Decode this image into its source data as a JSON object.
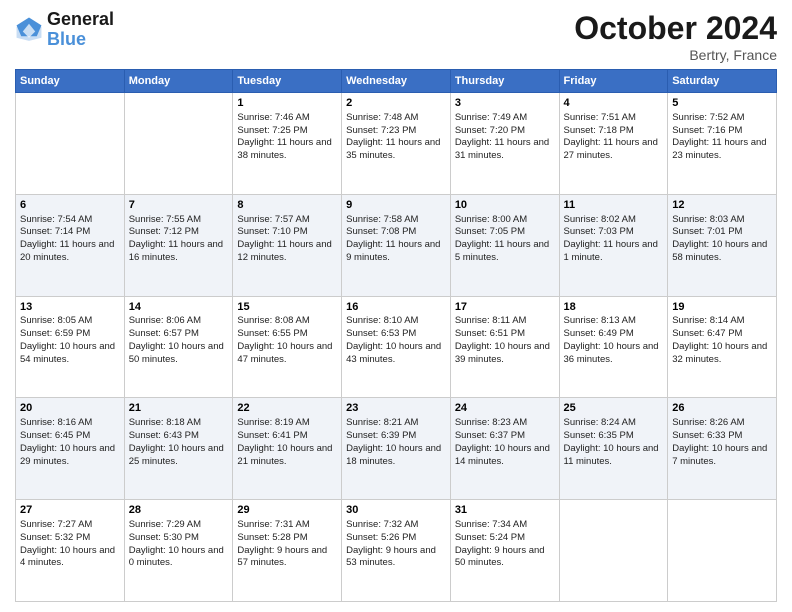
{
  "header": {
    "logo_line1": "General",
    "logo_line2": "Blue",
    "month_title": "October 2024",
    "location": "Bertry, France"
  },
  "days_of_week": [
    "Sunday",
    "Monday",
    "Tuesday",
    "Wednesday",
    "Thursday",
    "Friday",
    "Saturday"
  ],
  "weeks": [
    [
      {
        "day": "",
        "sunrise": "",
        "sunset": "",
        "daylight": ""
      },
      {
        "day": "",
        "sunrise": "",
        "sunset": "",
        "daylight": ""
      },
      {
        "day": "1",
        "sunrise": "Sunrise: 7:46 AM",
        "sunset": "Sunset: 7:25 PM",
        "daylight": "Daylight: 11 hours and 38 minutes."
      },
      {
        "day": "2",
        "sunrise": "Sunrise: 7:48 AM",
        "sunset": "Sunset: 7:23 PM",
        "daylight": "Daylight: 11 hours and 35 minutes."
      },
      {
        "day": "3",
        "sunrise": "Sunrise: 7:49 AM",
        "sunset": "Sunset: 7:20 PM",
        "daylight": "Daylight: 11 hours and 31 minutes."
      },
      {
        "day": "4",
        "sunrise": "Sunrise: 7:51 AM",
        "sunset": "Sunset: 7:18 PM",
        "daylight": "Daylight: 11 hours and 27 minutes."
      },
      {
        "day": "5",
        "sunrise": "Sunrise: 7:52 AM",
        "sunset": "Sunset: 7:16 PM",
        "daylight": "Daylight: 11 hours and 23 minutes."
      }
    ],
    [
      {
        "day": "6",
        "sunrise": "Sunrise: 7:54 AM",
        "sunset": "Sunset: 7:14 PM",
        "daylight": "Daylight: 11 hours and 20 minutes."
      },
      {
        "day": "7",
        "sunrise": "Sunrise: 7:55 AM",
        "sunset": "Sunset: 7:12 PM",
        "daylight": "Daylight: 11 hours and 16 minutes."
      },
      {
        "day": "8",
        "sunrise": "Sunrise: 7:57 AM",
        "sunset": "Sunset: 7:10 PM",
        "daylight": "Daylight: 11 hours and 12 minutes."
      },
      {
        "day": "9",
        "sunrise": "Sunrise: 7:58 AM",
        "sunset": "Sunset: 7:08 PM",
        "daylight": "Daylight: 11 hours and 9 minutes."
      },
      {
        "day": "10",
        "sunrise": "Sunrise: 8:00 AM",
        "sunset": "Sunset: 7:05 PM",
        "daylight": "Daylight: 11 hours and 5 minutes."
      },
      {
        "day": "11",
        "sunrise": "Sunrise: 8:02 AM",
        "sunset": "Sunset: 7:03 PM",
        "daylight": "Daylight: 11 hours and 1 minute."
      },
      {
        "day": "12",
        "sunrise": "Sunrise: 8:03 AM",
        "sunset": "Sunset: 7:01 PM",
        "daylight": "Daylight: 10 hours and 58 minutes."
      }
    ],
    [
      {
        "day": "13",
        "sunrise": "Sunrise: 8:05 AM",
        "sunset": "Sunset: 6:59 PM",
        "daylight": "Daylight: 10 hours and 54 minutes."
      },
      {
        "day": "14",
        "sunrise": "Sunrise: 8:06 AM",
        "sunset": "Sunset: 6:57 PM",
        "daylight": "Daylight: 10 hours and 50 minutes."
      },
      {
        "day": "15",
        "sunrise": "Sunrise: 8:08 AM",
        "sunset": "Sunset: 6:55 PM",
        "daylight": "Daylight: 10 hours and 47 minutes."
      },
      {
        "day": "16",
        "sunrise": "Sunrise: 8:10 AM",
        "sunset": "Sunset: 6:53 PM",
        "daylight": "Daylight: 10 hours and 43 minutes."
      },
      {
        "day": "17",
        "sunrise": "Sunrise: 8:11 AM",
        "sunset": "Sunset: 6:51 PM",
        "daylight": "Daylight: 10 hours and 39 minutes."
      },
      {
        "day": "18",
        "sunrise": "Sunrise: 8:13 AM",
        "sunset": "Sunset: 6:49 PM",
        "daylight": "Daylight: 10 hours and 36 minutes."
      },
      {
        "day": "19",
        "sunrise": "Sunrise: 8:14 AM",
        "sunset": "Sunset: 6:47 PM",
        "daylight": "Daylight: 10 hours and 32 minutes."
      }
    ],
    [
      {
        "day": "20",
        "sunrise": "Sunrise: 8:16 AM",
        "sunset": "Sunset: 6:45 PM",
        "daylight": "Daylight: 10 hours and 29 minutes."
      },
      {
        "day": "21",
        "sunrise": "Sunrise: 8:18 AM",
        "sunset": "Sunset: 6:43 PM",
        "daylight": "Daylight: 10 hours and 25 minutes."
      },
      {
        "day": "22",
        "sunrise": "Sunrise: 8:19 AM",
        "sunset": "Sunset: 6:41 PM",
        "daylight": "Daylight: 10 hours and 21 minutes."
      },
      {
        "day": "23",
        "sunrise": "Sunrise: 8:21 AM",
        "sunset": "Sunset: 6:39 PM",
        "daylight": "Daylight: 10 hours and 18 minutes."
      },
      {
        "day": "24",
        "sunrise": "Sunrise: 8:23 AM",
        "sunset": "Sunset: 6:37 PM",
        "daylight": "Daylight: 10 hours and 14 minutes."
      },
      {
        "day": "25",
        "sunrise": "Sunrise: 8:24 AM",
        "sunset": "Sunset: 6:35 PM",
        "daylight": "Daylight: 10 hours and 11 minutes."
      },
      {
        "day": "26",
        "sunrise": "Sunrise: 8:26 AM",
        "sunset": "Sunset: 6:33 PM",
        "daylight": "Daylight: 10 hours and 7 minutes."
      }
    ],
    [
      {
        "day": "27",
        "sunrise": "Sunrise: 7:27 AM",
        "sunset": "Sunset: 5:32 PM",
        "daylight": "Daylight: 10 hours and 4 minutes."
      },
      {
        "day": "28",
        "sunrise": "Sunrise: 7:29 AM",
        "sunset": "Sunset: 5:30 PM",
        "daylight": "Daylight: 10 hours and 0 minutes."
      },
      {
        "day": "29",
        "sunrise": "Sunrise: 7:31 AM",
        "sunset": "Sunset: 5:28 PM",
        "daylight": "Daylight: 9 hours and 57 minutes."
      },
      {
        "day": "30",
        "sunrise": "Sunrise: 7:32 AM",
        "sunset": "Sunset: 5:26 PM",
        "daylight": "Daylight: 9 hours and 53 minutes."
      },
      {
        "day": "31",
        "sunrise": "Sunrise: 7:34 AM",
        "sunset": "Sunset: 5:24 PM",
        "daylight": "Daylight: 9 hours and 50 minutes."
      },
      {
        "day": "",
        "sunrise": "",
        "sunset": "",
        "daylight": ""
      },
      {
        "day": "",
        "sunrise": "",
        "sunset": "",
        "daylight": ""
      }
    ]
  ]
}
